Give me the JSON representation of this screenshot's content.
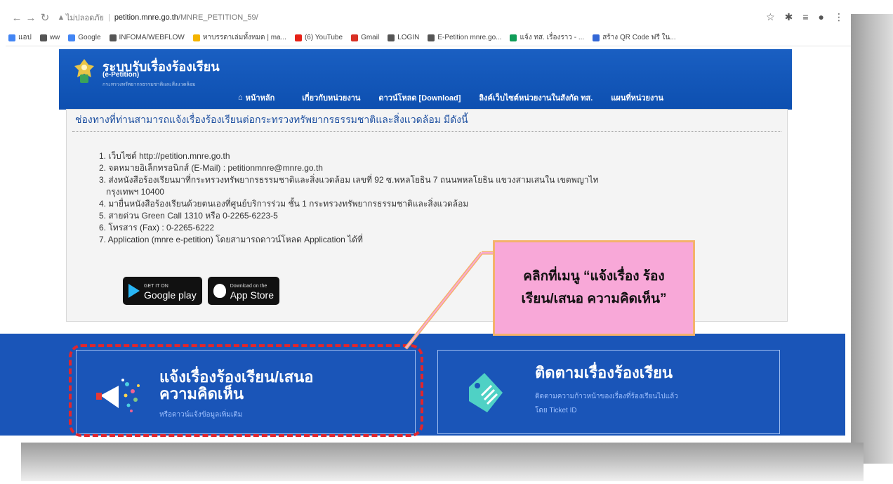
{
  "browser": {
    "not_secure": "ไม่ปลอดภัย",
    "host": "petition.mnre.go.th",
    "path": "/MNRE_PETITION_59/",
    "bookmarks": [
      {
        "label": "แอป",
        "color": "#4285f4"
      },
      {
        "label": "ww",
        "color": "#555555"
      },
      {
        "label": "Google",
        "color": "#4285f4"
      },
      {
        "label": "INFOMA/WEBFLOW",
        "color": "#555555"
      },
      {
        "label": "หาบรรดาเล่มทั้งหมด | ma...",
        "color": "#f4b400"
      },
      {
        "label": "(6) YouTube",
        "color": "#e62117"
      },
      {
        "label": "Gmail",
        "color": "#d93025"
      },
      {
        "label": "LOGIN",
        "color": "#555555"
      },
      {
        "label": "E-Petition mnre.go...",
        "color": "#555555"
      },
      {
        "label": "แจ้ง ทส. เรื่องราว - ...",
        "color": "#0f9d58"
      },
      {
        "label": "สร้าง QR Code ฟรี ใน...",
        "color": "#3367d6"
      }
    ]
  },
  "site": {
    "title": "ระบบรับเรื่องร้องเรียน",
    "subtitle": "(e-Petition)",
    "tagline": "กระทรวงทรัพยากรธรรมชาติและสิ่งแวดล้อม",
    "menu": [
      "หน้าหลัก",
      "เกี่ยวกับหน่วยงาน",
      "ดาวน์โหลด [Download]",
      "ลิงค์เว็บไซต์หน่วยงานในสังกัด ทส.",
      "แผนที่หน่วยงาน"
    ]
  },
  "panel": {
    "heading": "ช่องทางที่ท่านสามารถแจ้งเรื่องร้องเรียนต่อกระทรวงทรัพยากรธรรมชาติและสิ่งแวดล้อม มีดังนี้",
    "items": [
      "1. เว็บไซต์ http://petition.mnre.go.th",
      "2. จดหมายอิเล็กทรอนิกส์ (E-Mail) : petitionmnre@mnre.go.th",
      "3. ส่งหนังสือร้องเรียนมาที่กระทรวงทรัพยากรธรรมชาติและสิ่งแวดล้อม เลขที่ 92 ซ.พหลโยธิน 7 ถนนพหลโยธิน แขวงสามเสนใน เขตพญาไท",
      "กรุงเทพฯ 10400",
      "4. มายื่นหนังสือร้องเรียนด้วยตนเองที่ศูนย์บริการร่วม ชั้น 1 กระทรวงทรัพยากรธรรมชาติและสิ่งแวดล้อม",
      "5. สายด่วน Green Call 1310 หรือ 0-2265-6223-5",
      "6. โทรสาร (Fax) : 0-2265-6222",
      "7. Application (mnre e-petition) โดยสามารถดาวน์โหลด Application ได้ที่"
    ],
    "google_play": {
      "small": "GET IT ON",
      "big": "Google play"
    },
    "app_store": {
      "small": "Download on the",
      "big": "App Store"
    }
  },
  "cards": {
    "report": {
      "title_line1": "แจ้งเรื่องร้องเรียน/เสนอ",
      "title_line2": "ความคิดเห็น",
      "sub": "หรือดาวน์แจ้งข้อมูลเพิ่มเติม"
    },
    "track": {
      "title": "ติดตามเรื่องร้องเรียน",
      "sub_line1": "ติดตามความก้าวหน้าของเรื่องที่ร้องเรียนไปแล้ว",
      "sub_line2": "โดย Ticket ID"
    }
  },
  "callout": {
    "text": "คลิกที่เมนู “แจ้งเรื่อง ร้องเรียน/เสนอ ความคิดเห็น”"
  },
  "colors": {
    "brand_blue": "#1a55b8",
    "callout_pink": "#f8a8d8",
    "highlight_red": "#e1262d"
  }
}
